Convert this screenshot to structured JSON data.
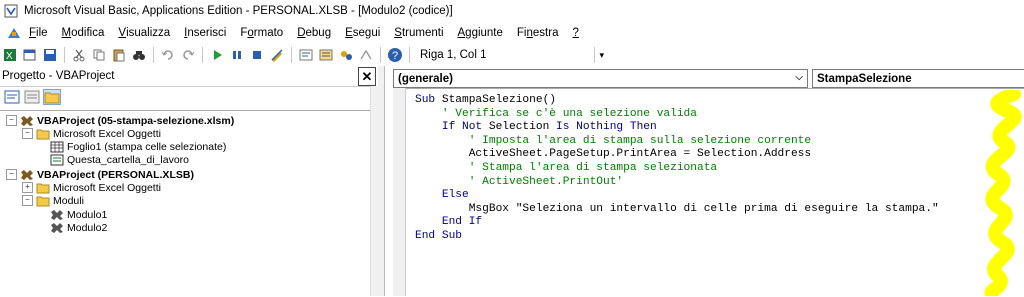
{
  "window": {
    "title": "Microsoft Visual Basic, Applications Edition - PERSONAL.XLSB - [Modulo2 (codice)]"
  },
  "menu": {
    "items": [
      {
        "label": "File",
        "key": "F"
      },
      {
        "label": "Modifica",
        "key": "M"
      },
      {
        "label": "Visualizza",
        "key": "V"
      },
      {
        "label": "Inserisci",
        "key": "I"
      },
      {
        "label": "Formato",
        "key": "o"
      },
      {
        "label": "Debug",
        "key": "D"
      },
      {
        "label": "Esegui",
        "key": "E"
      },
      {
        "label": "Strumenti",
        "key": "S"
      },
      {
        "label": "Aggiunte",
        "key": "A"
      },
      {
        "label": "Finestra",
        "key": "n"
      },
      {
        "label": "?",
        "key": "?"
      }
    ]
  },
  "toolbar": {
    "position": "Riga 1, Col 1"
  },
  "project": {
    "title": "Progetto - VBAProject",
    "tree": [
      {
        "label": "VBAProject (05-stampa-selezione.xlsm)",
        "bold": true
      },
      {
        "label": "Microsoft Excel Oggetti"
      },
      {
        "label": "Foglio1 (stampa celle selezionate)"
      },
      {
        "label": "Questa_cartella_di_lavoro"
      },
      {
        "label": "VBAProject (PERSONAL.XLSB)",
        "bold": true
      },
      {
        "label": "Microsoft Excel Oggetti"
      },
      {
        "label": "Moduli"
      },
      {
        "label": "Modulo1"
      },
      {
        "label": "Modulo2"
      }
    ]
  },
  "code_window": {
    "object_combo": "(generale)",
    "procedure_combo": "StampaSelezione",
    "lines": [
      {
        "indent": "",
        "kw": "Sub ",
        "text": "StampaSelezione()",
        "comment": ""
      },
      {
        "indent": "    ",
        "kw": "",
        "text": "",
        "comment": "' Verifica se c'è una selezione valida"
      },
      {
        "indent": "    ",
        "kw": "If Not ",
        "text": "Selection ",
        "kw2": "Is Nothing Then",
        "comment": ""
      },
      {
        "indent": "        ",
        "kw": "",
        "text": "",
        "comment": "' Imposta l'area di stampa sulla selezione corrente"
      },
      {
        "indent": "        ",
        "kw": "",
        "text": "ActiveSheet.PageSetup.PrintArea = Selection.Address",
        "comment": ""
      },
      {
        "indent": "        ",
        "kw": "",
        "text": "",
        "comment": "' Stampa l'area di stampa selezionata"
      },
      {
        "indent": "        ",
        "kw": "",
        "text": "",
        "comment": "' ActiveSheet.PrintOut'"
      },
      {
        "indent": "    ",
        "kw": "Else",
        "text": "",
        "comment": ""
      },
      {
        "indent": "        ",
        "kw": "",
        "text": "MsgBox \"Seleziona un intervallo di celle prima di eseguire la stampa.\"",
        "comment": ""
      },
      {
        "indent": "    ",
        "kw": "End If",
        "text": "",
        "comment": ""
      },
      {
        "indent": "",
        "kw": "End Sub",
        "text": "",
        "comment": ""
      }
    ]
  },
  "colors": {
    "keyword": "#00008b",
    "comment": "#008000",
    "highlight": "#ffff00"
  }
}
